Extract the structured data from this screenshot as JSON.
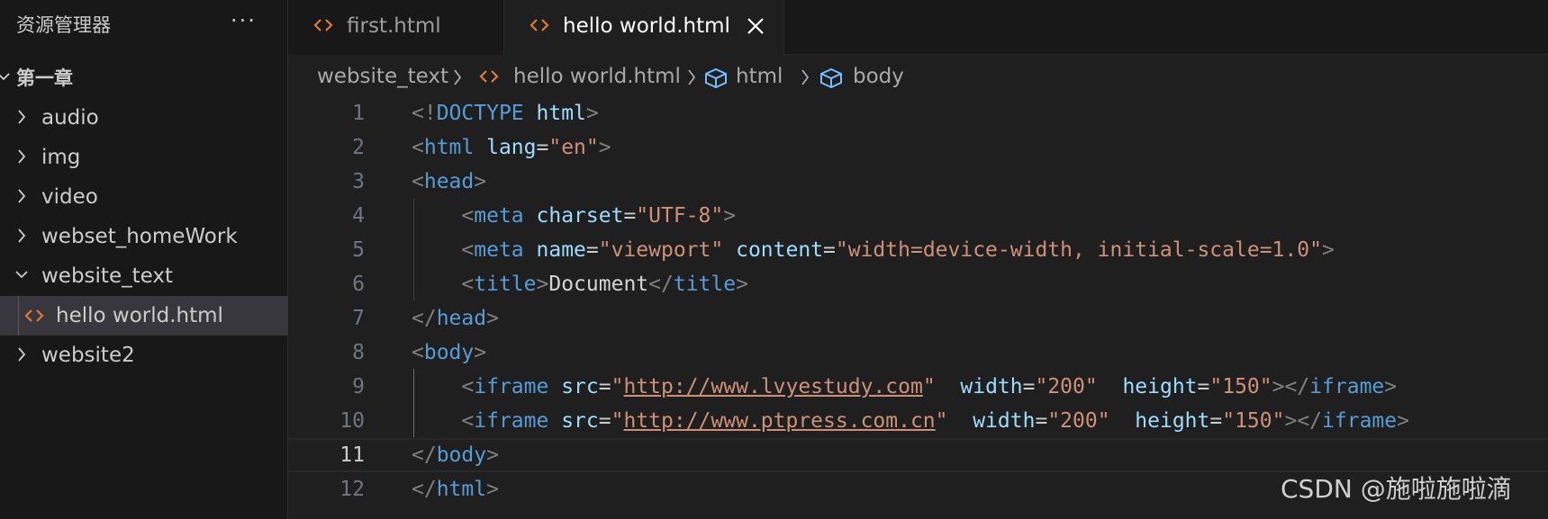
{
  "explorer": {
    "title": "资源管理器",
    "more_label": "···",
    "root": {
      "label": "第一章",
      "expanded": true
    },
    "items": [
      {
        "label": "audio",
        "type": "folder",
        "expanded": false
      },
      {
        "label": "img",
        "type": "folder",
        "expanded": false
      },
      {
        "label": "video",
        "type": "folder",
        "expanded": false
      },
      {
        "label": "webset_homeWork",
        "type": "folder",
        "expanded": false
      },
      {
        "label": "website_text",
        "type": "folder",
        "expanded": true
      },
      {
        "label": "hello world.html",
        "type": "file",
        "selected": true
      },
      {
        "label": "website2",
        "type": "folder",
        "expanded": false
      }
    ]
  },
  "tabs": [
    {
      "label": "first.html",
      "active": false
    },
    {
      "label": "hello world.html",
      "active": true
    }
  ],
  "breadcrumb": [
    "website_text",
    "hello world.html",
    "html",
    "body"
  ],
  "editor": {
    "current_line": 11,
    "line_numbers": [
      "1",
      "2",
      "3",
      "4",
      "5",
      "6",
      "7",
      "8",
      "9",
      "10",
      "11",
      "12"
    ],
    "lines": [
      "<!DOCTYPE html>",
      "<html lang=\"en\">",
      "<head>",
      "    <meta charset=\"UTF-8\">",
      "    <meta name=\"viewport\" content=\"width=device-width, initial-scale=1.0\">",
      "    <title>Document</title>",
      "</head>",
      "<body>",
      "    <iframe src=\"http://www.lvyestudy.com\"  width=\"200\"  height=\"150\"></iframe>",
      "    <iframe src=\"http://www.ptpress.com.cn\"  width=\"200\"  height=\"150\"></iframe>",
      "</body>",
      "</html>"
    ]
  },
  "watermark": "CSDN @施啦施啦滴",
  "colors": {
    "html_file_icon": "#e37933",
    "tag": "#569cd6",
    "attribute": "#9cdcfe",
    "string": "#ce9178",
    "bracket": "#808080"
  }
}
